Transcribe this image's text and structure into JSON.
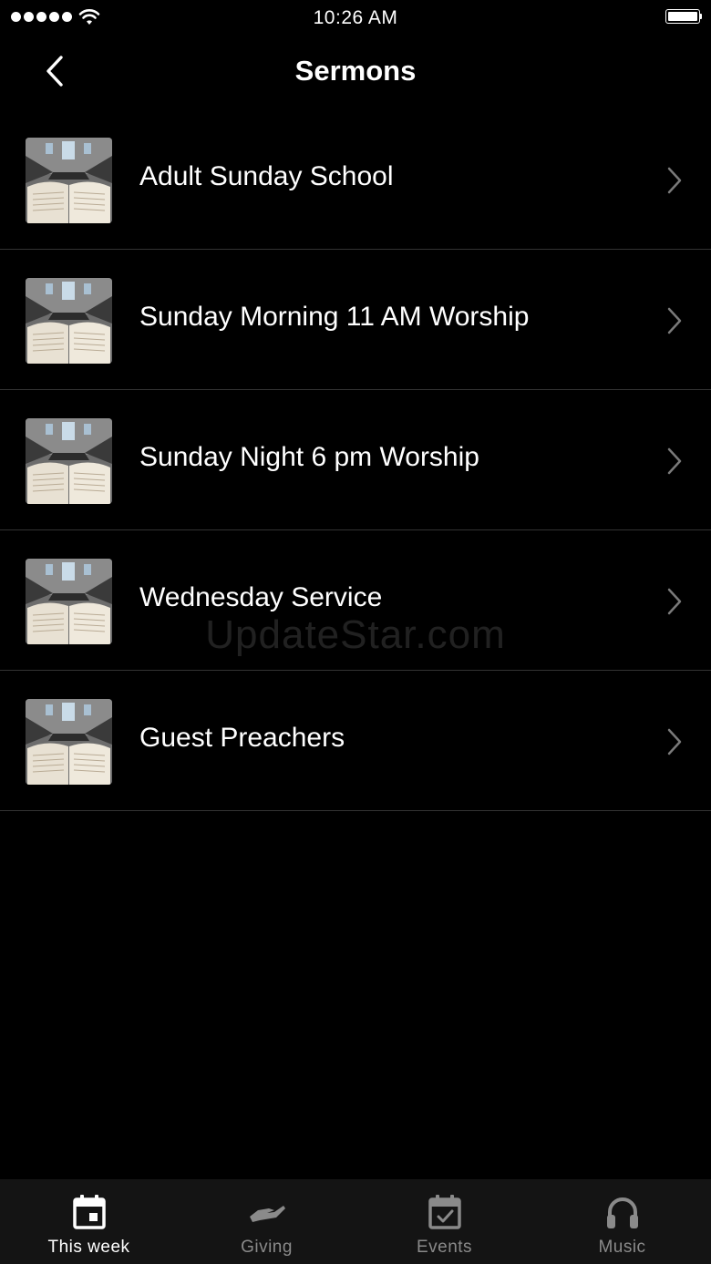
{
  "status_bar": {
    "time": "10:26 AM",
    "signal_icon": "signal-dots-icon",
    "wifi_icon": "wifi-icon",
    "battery_icon": "battery-full-icon"
  },
  "nav": {
    "title": "Sermons",
    "back_icon": "chevron-left-icon"
  },
  "sermons": {
    "items": [
      {
        "label": "Adult Sunday School",
        "thumb_icon": "bible-thumbnail"
      },
      {
        "label": "Sunday Morning 11 AM Worship",
        "thumb_icon": "bible-thumbnail"
      },
      {
        "label": "Sunday Night 6 pm Worship",
        "thumb_icon": "bible-thumbnail"
      },
      {
        "label": "Wednesday Service",
        "thumb_icon": "bible-thumbnail"
      },
      {
        "label": "Guest Preachers",
        "thumb_icon": "bible-thumbnail"
      }
    ]
  },
  "watermark": "UpdateStar.com",
  "tab_bar": {
    "tabs": [
      {
        "label": "This week",
        "icon": "calendar-icon",
        "active": true
      },
      {
        "label": "Giving",
        "icon": "giving-hand-icon",
        "active": false
      },
      {
        "label": "Events",
        "icon": "calendar-check-icon",
        "active": false
      },
      {
        "label": "Music",
        "icon": "headphones-icon",
        "active": false
      }
    ]
  },
  "colors": {
    "background": "#000000",
    "text": "#ffffff",
    "divider": "#333333",
    "tab_bar_bg": "#141414",
    "inactive_tab": "#8a8a8a"
  }
}
